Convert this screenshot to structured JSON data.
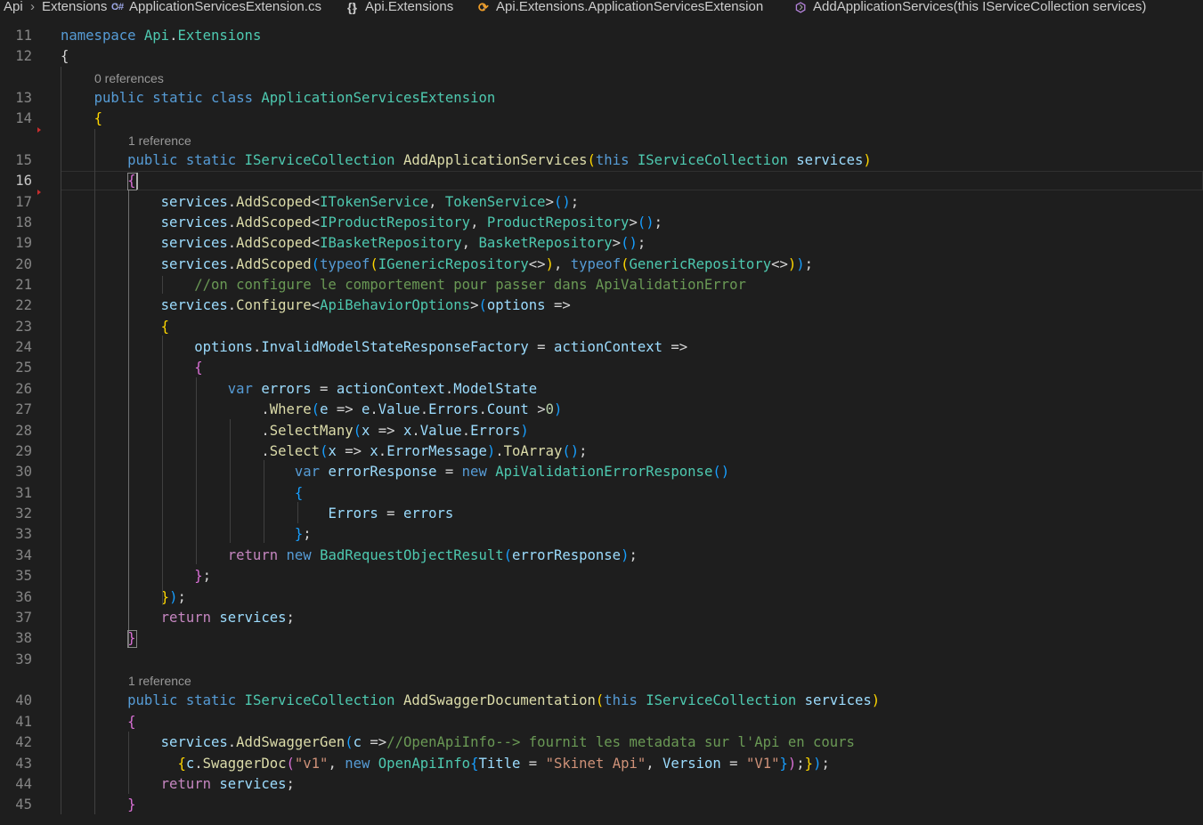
{
  "breadcrumb": {
    "items": [
      {
        "label": "Api"
      },
      {
        "label": "Extensions"
      },
      {
        "label": "ApplicationServicesExtension.cs",
        "icon": "csharp-file-icon"
      },
      {
        "label": "Api.Extensions",
        "icon": "namespace-braces-icon"
      },
      {
        "label": "Api.Extensions.ApplicationServicesExtension",
        "icon": "class-icon"
      },
      {
        "label": "AddApplicationServices(this IServiceCollection services)",
        "icon": "method-cube-icon"
      }
    ],
    "icon_glyphs": {
      "csharp": "C#",
      "braces": "{}",
      "class": "⟳",
      "method": "⬡"
    }
  },
  "editor": {
    "active_line": 16,
    "codelens": [
      {
        "before_line": 13,
        "text": "0 references"
      },
      {
        "before_line": 15,
        "text": "1 reference"
      },
      {
        "before_line": 40,
        "text": "1 reference"
      }
    ],
    "lines": [
      {
        "num": "11",
        "tokens": [
          [
            "k",
            "namespace"
          ],
          [
            "p",
            " "
          ],
          [
            "t",
            "Api"
          ],
          [
            "p",
            "."
          ],
          [
            "t",
            "Extensions"
          ]
        ]
      },
      {
        "num": "12",
        "tokens": [
          [
            "p",
            "{"
          ]
        ]
      },
      {
        "num": "13",
        "tokens": [
          [
            "p",
            "    "
          ],
          [
            "k",
            "public"
          ],
          [
            "p",
            " "
          ],
          [
            "k",
            "static"
          ],
          [
            "p",
            " "
          ],
          [
            "k",
            "class"
          ],
          [
            "p",
            " "
          ],
          [
            "t",
            "ApplicationServicesExtension"
          ]
        ]
      },
      {
        "num": "14",
        "tokens": [
          [
            "p",
            "    "
          ],
          [
            "b1",
            "{"
          ]
        ]
      },
      {
        "num": "15",
        "tokens": [
          [
            "p",
            "        "
          ],
          [
            "k",
            "public"
          ],
          [
            "p",
            " "
          ],
          [
            "k",
            "static"
          ],
          [
            "p",
            " "
          ],
          [
            "t",
            "IServiceCollection"
          ],
          [
            "p",
            " "
          ],
          [
            "f",
            "AddApplicationServices"
          ],
          [
            "b1",
            "("
          ],
          [
            "k",
            "this"
          ],
          [
            "p",
            " "
          ],
          [
            "t",
            "IServiceCollection"
          ],
          [
            "p",
            " "
          ],
          [
            "v",
            "services"
          ],
          [
            "b1",
            ")"
          ]
        ]
      },
      {
        "num": "16",
        "tokens": [
          [
            "p",
            "        "
          ],
          [
            "b2",
            "{"
          ]
        ]
      },
      {
        "num": "17",
        "tokens": [
          [
            "p",
            "            "
          ],
          [
            "v",
            "services"
          ],
          [
            "p",
            "."
          ],
          [
            "f",
            "AddScoped"
          ],
          [
            "p",
            "<"
          ],
          [
            "t",
            "ITokenService"
          ],
          [
            "p",
            ", "
          ],
          [
            "t",
            "TokenService"
          ],
          [
            "p",
            ">"
          ],
          [
            "b3",
            "()"
          ],
          [
            "p",
            ";"
          ]
        ]
      },
      {
        "num": "18",
        "tokens": [
          [
            "p",
            "            "
          ],
          [
            "v",
            "services"
          ],
          [
            "p",
            "."
          ],
          [
            "f",
            "AddScoped"
          ],
          [
            "p",
            "<"
          ],
          [
            "t",
            "IProductRepository"
          ],
          [
            "p",
            ", "
          ],
          [
            "t",
            "ProductRepository"
          ],
          [
            "p",
            ">"
          ],
          [
            "b3",
            "()"
          ],
          [
            "p",
            ";"
          ]
        ]
      },
      {
        "num": "19",
        "tokens": [
          [
            "p",
            "            "
          ],
          [
            "v",
            "services"
          ],
          [
            "p",
            "."
          ],
          [
            "f",
            "AddScoped"
          ],
          [
            "p",
            "<"
          ],
          [
            "t",
            "IBasketRepository"
          ],
          [
            "p",
            ", "
          ],
          [
            "t",
            "BasketRepository"
          ],
          [
            "p",
            ">"
          ],
          [
            "b3",
            "()"
          ],
          [
            "p",
            ";"
          ]
        ]
      },
      {
        "num": "20",
        "tokens": [
          [
            "p",
            "            "
          ],
          [
            "v",
            "services"
          ],
          [
            "p",
            "."
          ],
          [
            "f",
            "AddScoped"
          ],
          [
            "b3",
            "("
          ],
          [
            "k",
            "typeof"
          ],
          [
            "b1",
            "("
          ],
          [
            "t",
            "IGenericRepository"
          ],
          [
            "p",
            "<>"
          ],
          [
            "b1",
            ")"
          ],
          [
            "p",
            ", "
          ],
          [
            "k",
            "typeof"
          ],
          [
            "b1",
            "("
          ],
          [
            "t",
            "GenericRepository"
          ],
          [
            "p",
            "<>"
          ],
          [
            "b1",
            ")"
          ],
          [
            "b3",
            ")"
          ],
          [
            "p",
            ";"
          ]
        ]
      },
      {
        "num": "21",
        "tokens": [
          [
            "p",
            "                "
          ],
          [
            "c",
            "//on configure le comportement pour passer dans ApiValidationError"
          ]
        ]
      },
      {
        "num": "22",
        "tokens": [
          [
            "p",
            "            "
          ],
          [
            "v",
            "services"
          ],
          [
            "p",
            "."
          ],
          [
            "f",
            "Configure"
          ],
          [
            "p",
            "<"
          ],
          [
            "t",
            "ApiBehaviorOptions"
          ],
          [
            "p",
            ">"
          ],
          [
            "b3",
            "("
          ],
          [
            "v",
            "options"
          ],
          [
            "p",
            " =>"
          ]
        ]
      },
      {
        "num": "23",
        "tokens": [
          [
            "p",
            "            "
          ],
          [
            "b1",
            "{"
          ]
        ]
      },
      {
        "num": "24",
        "tokens": [
          [
            "p",
            "                "
          ],
          [
            "v",
            "options"
          ],
          [
            "p",
            "."
          ],
          [
            "v",
            "InvalidModelStateResponseFactory"
          ],
          [
            "p",
            " = "
          ],
          [
            "v",
            "actionContext"
          ],
          [
            "p",
            " =>"
          ]
        ]
      },
      {
        "num": "25",
        "tokens": [
          [
            "p",
            "                "
          ],
          [
            "b2",
            "{"
          ]
        ]
      },
      {
        "num": "26",
        "tokens": [
          [
            "p",
            "                    "
          ],
          [
            "k",
            "var"
          ],
          [
            "p",
            " "
          ],
          [
            "v",
            "errors"
          ],
          [
            "p",
            " = "
          ],
          [
            "v",
            "actionContext"
          ],
          [
            "p",
            "."
          ],
          [
            "v",
            "ModelState"
          ]
        ]
      },
      {
        "num": "27",
        "tokens": [
          [
            "p",
            "                        ."
          ],
          [
            "f",
            "Where"
          ],
          [
            "b3",
            "("
          ],
          [
            "v",
            "e"
          ],
          [
            "p",
            " => "
          ],
          [
            "v",
            "e"
          ],
          [
            "p",
            "."
          ],
          [
            "v",
            "Value"
          ],
          [
            "p",
            "."
          ],
          [
            "v",
            "Errors"
          ],
          [
            "p",
            "."
          ],
          [
            "v",
            "Count"
          ],
          [
            "p",
            " >"
          ],
          [
            "n",
            "0"
          ],
          [
            "b3",
            ")"
          ]
        ]
      },
      {
        "num": "28",
        "tokens": [
          [
            "p",
            "                        ."
          ],
          [
            "f",
            "SelectMany"
          ],
          [
            "b3",
            "("
          ],
          [
            "v",
            "x"
          ],
          [
            "p",
            " => "
          ],
          [
            "v",
            "x"
          ],
          [
            "p",
            "."
          ],
          [
            "v",
            "Value"
          ],
          [
            "p",
            "."
          ],
          [
            "v",
            "Errors"
          ],
          [
            "b3",
            ")"
          ]
        ]
      },
      {
        "num": "29",
        "tokens": [
          [
            "p",
            "                        ."
          ],
          [
            "f",
            "Select"
          ],
          [
            "b3",
            "("
          ],
          [
            "v",
            "x"
          ],
          [
            "p",
            " => "
          ],
          [
            "v",
            "x"
          ],
          [
            "p",
            "."
          ],
          [
            "v",
            "ErrorMessage"
          ],
          [
            "b3",
            ")"
          ],
          [
            "p",
            "."
          ],
          [
            "f",
            "ToArray"
          ],
          [
            "b3",
            "()"
          ],
          [
            "p",
            ";"
          ]
        ]
      },
      {
        "num": "30",
        "tokens": [
          [
            "p",
            "                            "
          ],
          [
            "k",
            "var"
          ],
          [
            "p",
            " "
          ],
          [
            "v",
            "errorResponse"
          ],
          [
            "p",
            " = "
          ],
          [
            "k",
            "new"
          ],
          [
            "p",
            " "
          ],
          [
            "t",
            "ApiValidationErrorResponse"
          ],
          [
            "b3",
            "()"
          ]
        ]
      },
      {
        "num": "31",
        "tokens": [
          [
            "p",
            "                            "
          ],
          [
            "b3",
            "{"
          ]
        ]
      },
      {
        "num": "32",
        "tokens": [
          [
            "p",
            "                                "
          ],
          [
            "v",
            "Errors"
          ],
          [
            "p",
            " = "
          ],
          [
            "v",
            "errors"
          ]
        ]
      },
      {
        "num": "33",
        "tokens": [
          [
            "p",
            "                            "
          ],
          [
            "b3",
            "}"
          ],
          [
            "p",
            ";"
          ]
        ]
      },
      {
        "num": "34",
        "tokens": [
          [
            "p",
            "                    "
          ],
          [
            "x",
            "return"
          ],
          [
            "p",
            " "
          ],
          [
            "k",
            "new"
          ],
          [
            "p",
            " "
          ],
          [
            "t",
            "BadRequestObjectResult"
          ],
          [
            "b3",
            "("
          ],
          [
            "v",
            "errorResponse"
          ],
          [
            "b3",
            ")"
          ],
          [
            "p",
            ";"
          ]
        ]
      },
      {
        "num": "35",
        "tokens": [
          [
            "p",
            "                "
          ],
          [
            "b2",
            "}"
          ],
          [
            "p",
            ";"
          ]
        ]
      },
      {
        "num": "36",
        "tokens": [
          [
            "p",
            "            "
          ],
          [
            "b1",
            "}"
          ],
          [
            "b3",
            ")"
          ],
          [
            "p",
            ";"
          ]
        ]
      },
      {
        "num": "37",
        "tokens": [
          [
            "p",
            "            "
          ],
          [
            "x",
            "return"
          ],
          [
            "p",
            " "
          ],
          [
            "v",
            "services"
          ],
          [
            "p",
            ";"
          ]
        ]
      },
      {
        "num": "38",
        "tokens": [
          [
            "p",
            "        "
          ],
          [
            "b2",
            "}"
          ]
        ]
      },
      {
        "num": "39",
        "tokens": []
      },
      {
        "num": "40",
        "tokens": [
          [
            "p",
            "        "
          ],
          [
            "k",
            "public"
          ],
          [
            "p",
            " "
          ],
          [
            "k",
            "static"
          ],
          [
            "p",
            " "
          ],
          [
            "t",
            "IServiceCollection"
          ],
          [
            "p",
            " "
          ],
          [
            "f",
            "AddSwaggerDocumentation"
          ],
          [
            "b1",
            "("
          ],
          [
            "k",
            "this"
          ],
          [
            "p",
            " "
          ],
          [
            "t",
            "IServiceCollection"
          ],
          [
            "p",
            " "
          ],
          [
            "v",
            "services"
          ],
          [
            "b1",
            ")"
          ]
        ]
      },
      {
        "num": "41",
        "tokens": [
          [
            "p",
            "        "
          ],
          [
            "b2",
            "{"
          ]
        ]
      },
      {
        "num": "42",
        "tokens": [
          [
            "p",
            "            "
          ],
          [
            "v",
            "services"
          ],
          [
            "p",
            "."
          ],
          [
            "f",
            "AddSwaggerGen"
          ],
          [
            "b3",
            "("
          ],
          [
            "v",
            "c"
          ],
          [
            "p",
            " =>"
          ],
          [
            "c",
            "//OpenApiInfo--> fournit les metadata sur l'Api en cours"
          ]
        ]
      },
      {
        "num": "43",
        "tokens": [
          [
            "p",
            "              "
          ],
          [
            "b1",
            "{"
          ],
          [
            "v",
            "c"
          ],
          [
            "p",
            "."
          ],
          [
            "f",
            "SwaggerDoc"
          ],
          [
            "b2",
            "("
          ],
          [
            "s",
            "\"v1\""
          ],
          [
            "p",
            ", "
          ],
          [
            "k",
            "new"
          ],
          [
            "p",
            " "
          ],
          [
            "t",
            "OpenApiInfo"
          ],
          [
            "b3",
            "{"
          ],
          [
            "v",
            "Title"
          ],
          [
            "p",
            " = "
          ],
          [
            "s",
            "\"Skinet Api\""
          ],
          [
            "p",
            ", "
          ],
          [
            "v",
            "Version"
          ],
          [
            "p",
            " = "
          ],
          [
            "s",
            "\"V1\""
          ],
          [
            "b3",
            "}"
          ],
          [
            "b2",
            ")"
          ],
          [
            "p",
            ";"
          ],
          [
            "b1",
            "}"
          ],
          [
            "b3",
            ")"
          ],
          [
            "p",
            ";"
          ]
        ]
      },
      {
        "num": "44",
        "tokens": [
          [
            "p",
            "            "
          ],
          [
            "x",
            "return"
          ],
          [
            "p",
            " "
          ],
          [
            "v",
            "services"
          ],
          [
            "p",
            ";"
          ]
        ]
      },
      {
        "num": "45",
        "tokens": [
          [
            "p",
            "        "
          ],
          [
            "b2",
            "}"
          ]
        ]
      }
    ]
  }
}
